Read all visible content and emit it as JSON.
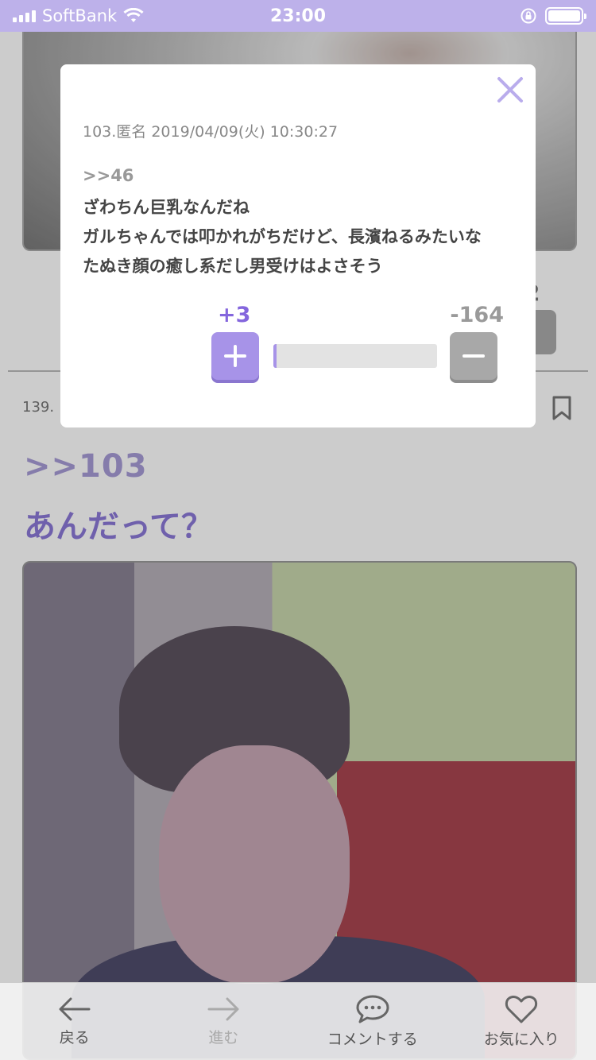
{
  "status_bar": {
    "carrier": "SoftBank",
    "time": "23:00"
  },
  "background_post": {
    "prev_vote_count": "2",
    "post_number": "139.",
    "reply_anchor": ">>103",
    "body": "あんだって？"
  },
  "modal": {
    "meta": "103.匿名 2019/04/09(火) 10:30:27",
    "reply_anchor": ">>46",
    "lines": [
      "ざわちん巨乳なんだね",
      "ガルちゃんでは叩かれがちだけど、長濱ねるみたいな",
      "たぬき顔の癒し系だし男受けはよさそう"
    ],
    "plus_count": "+3",
    "minus_count": "-164",
    "plus_ratio": 0.018
  },
  "toolbar": {
    "back_label": "戻る",
    "forward_label": "進む",
    "comment_label": "コメントする",
    "favorite_label": "お気に入り"
  },
  "colors": {
    "accent": "#8466dd",
    "status_bar": "#bdb1ea"
  }
}
